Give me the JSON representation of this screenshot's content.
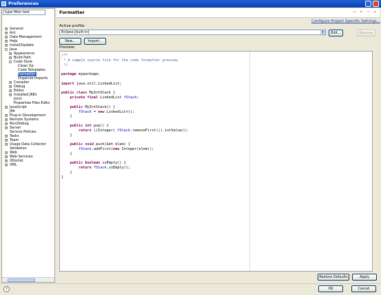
{
  "window": {
    "title": "Preferences"
  },
  "filter": {
    "text": "type filter text"
  },
  "tree": [
    {
      "label": "General",
      "exp": "+",
      "level": 0
    },
    {
      "label": "Ant",
      "exp": "+",
      "level": 0
    },
    {
      "label": "Data Management",
      "exp": "+",
      "level": 0
    },
    {
      "label": "Help",
      "exp": "+",
      "level": 0
    },
    {
      "label": "Install/Update",
      "exp": "+",
      "level": 0
    },
    {
      "label": "Java",
      "exp": "-",
      "level": 0
    },
    {
      "label": "Appearance",
      "exp": "+",
      "level": 1
    },
    {
      "label": "Build Path",
      "exp": "+",
      "level": 1
    },
    {
      "label": "Code Style",
      "exp": "-",
      "level": 1
    },
    {
      "label": "Clean Up",
      "exp": "",
      "level": 2
    },
    {
      "label": "Code Templates",
      "exp": "",
      "level": 2
    },
    {
      "label": "Formatter",
      "exp": "",
      "level": 2,
      "selected": true
    },
    {
      "label": "Organize Imports",
      "exp": "",
      "level": 2
    },
    {
      "label": "Compiler",
      "exp": "+",
      "level": 1
    },
    {
      "label": "Debug",
      "exp": "+",
      "level": 1
    },
    {
      "label": "Editor",
      "exp": "+",
      "level": 1
    },
    {
      "label": "Installed JREs",
      "exp": "+",
      "level": 1
    },
    {
      "label": "JUnit",
      "exp": "",
      "level": 1
    },
    {
      "label": "Properties Files Edito",
      "exp": "",
      "level": 1
    },
    {
      "label": "JavaScript",
      "exp": "+",
      "level": 0
    },
    {
      "label": "JPA",
      "exp": "",
      "level": 0
    },
    {
      "label": "Plug-in Development",
      "exp": "+",
      "level": 0
    },
    {
      "label": "Remote Systems",
      "exp": "+",
      "level": 0
    },
    {
      "label": "Run/Debug",
      "exp": "+",
      "level": 0
    },
    {
      "label": "Server",
      "exp": "+",
      "level": 0
    },
    {
      "label": "Service Policies",
      "exp": "",
      "level": 0
    },
    {
      "label": "Tasks",
      "exp": "+",
      "level": 0
    },
    {
      "label": "Team",
      "exp": "+",
      "level": 0
    },
    {
      "label": "Usage Data Collector",
      "exp": "+",
      "level": 0
    },
    {
      "label": "Validation",
      "exp": "",
      "level": 0
    },
    {
      "label": "Web",
      "exp": "+",
      "level": 0
    },
    {
      "label": "Web Services",
      "exp": "+",
      "level": 0
    },
    {
      "label": "XDoclet",
      "exp": "+",
      "level": 0
    },
    {
      "label": "XML",
      "exp": "+",
      "level": 0
    }
  ],
  "page": {
    "title": "Formatter",
    "nav_arrows": "⇦ ▾ ⇨ ▾",
    "config_link": "Configure Project Specific Settings...",
    "active_profile_label": "Active profile:",
    "active_profile_value": "Eclipse [built-in]",
    "edit_button": "Edit...",
    "remove_button": "Remove",
    "new_button": "New...",
    "import_button": "Import...",
    "preview_label": "Preview:",
    "restore_defaults_button": "Restore Defaults",
    "apply_button": "Apply",
    "ok_button": "OK",
    "cancel_button": "Cancel",
    "help_icon": "?"
  },
  "code_lines": [
    [
      {
        "t": "/**",
        "c": "cm"
      }
    ],
    [
      {
        "t": " * A sample source file for the code formatter preview",
        "c": "cm"
      }
    ],
    [
      {
        "t": " */",
        "c": "cm"
      }
    ],
    [],
    [
      {
        "t": "package",
        "c": "kw"
      },
      {
        "t": " mypackage;",
        "c": ""
      }
    ],
    [],
    [
      {
        "t": "import",
        "c": "kw"
      },
      {
        "t": " java.util.LinkedList;",
        "c": ""
      }
    ],
    [],
    [
      {
        "t": "public",
        "c": "kw"
      },
      {
        "t": " ",
        "c": ""
      },
      {
        "t": "class",
        "c": "kw"
      },
      {
        "t": " MyIntStack {",
        "c": ""
      }
    ],
    [
      {
        "t": "    ",
        "c": ""
      },
      {
        "t": "private",
        "c": "kw"
      },
      {
        "t": " ",
        "c": ""
      },
      {
        "t": "final",
        "c": "kw"
      },
      {
        "t": " LinkedList ",
        "c": ""
      },
      {
        "t": "fStack",
        "c": "fd"
      },
      {
        "t": ";",
        "c": ""
      }
    ],
    [],
    [
      {
        "t": "    ",
        "c": ""
      },
      {
        "t": "public",
        "c": "kw"
      },
      {
        "t": " MyIntStack() {",
        "c": ""
      }
    ],
    [
      {
        "t": "        ",
        "c": ""
      },
      {
        "t": "fStack",
        "c": "fd"
      },
      {
        "t": " = ",
        "c": ""
      },
      {
        "t": "new",
        "c": "kw"
      },
      {
        "t": " LinkedList();",
        "c": ""
      }
    ],
    [
      {
        "t": "    }",
        "c": ""
      }
    ],
    [],
    [
      {
        "t": "    ",
        "c": ""
      },
      {
        "t": "public",
        "c": "kw"
      },
      {
        "t": " ",
        "c": ""
      },
      {
        "t": "int",
        "c": "kw"
      },
      {
        "t": " pop() {",
        "c": ""
      }
    ],
    [
      {
        "t": "        ",
        "c": ""
      },
      {
        "t": "return",
        "c": "kw"
      },
      {
        "t": " ((Integer) ",
        "c": ""
      },
      {
        "t": "fStack",
        "c": "fd"
      },
      {
        "t": ".removeFirst()).intValue();",
        "c": ""
      }
    ],
    [
      {
        "t": "    }",
        "c": ""
      }
    ],
    [],
    [
      {
        "t": "    ",
        "c": ""
      },
      {
        "t": "public",
        "c": "kw"
      },
      {
        "t": " ",
        "c": ""
      },
      {
        "t": "void",
        "c": "kw"
      },
      {
        "t": " push(",
        "c": ""
      },
      {
        "t": "int",
        "c": "kw"
      },
      {
        "t": " elem) {",
        "c": ""
      }
    ],
    [
      {
        "t": "        ",
        "c": ""
      },
      {
        "t": "fStack",
        "c": "fd"
      },
      {
        "t": ".addFirst(",
        "c": ""
      },
      {
        "t": "new",
        "c": "kw"
      },
      {
        "t": " Integer(elem));",
        "c": ""
      }
    ],
    [
      {
        "t": "    }",
        "c": ""
      }
    ],
    [],
    [
      {
        "t": "    ",
        "c": ""
      },
      {
        "t": "public",
        "c": "kw"
      },
      {
        "t": " ",
        "c": ""
      },
      {
        "t": "boolean",
        "c": "kw"
      },
      {
        "t": " isEmpty() {",
        "c": ""
      }
    ],
    [
      {
        "t": "        ",
        "c": ""
      },
      {
        "t": "return",
        "c": "kw"
      },
      {
        "t": " ",
        "c": ""
      },
      {
        "t": "fStack",
        "c": "fd"
      },
      {
        "t": ".isEmpty();",
        "c": ""
      }
    ],
    [
      {
        "t": "    }",
        "c": ""
      }
    ],
    [
      {
        "t": "}",
        "c": ""
      }
    ]
  ],
  "colors": {
    "title_bar": "#0a3fae",
    "selection": "#316ac5",
    "keyword": "#7f0055",
    "comment": "#3f5fbf",
    "field": "#0000c0"
  }
}
